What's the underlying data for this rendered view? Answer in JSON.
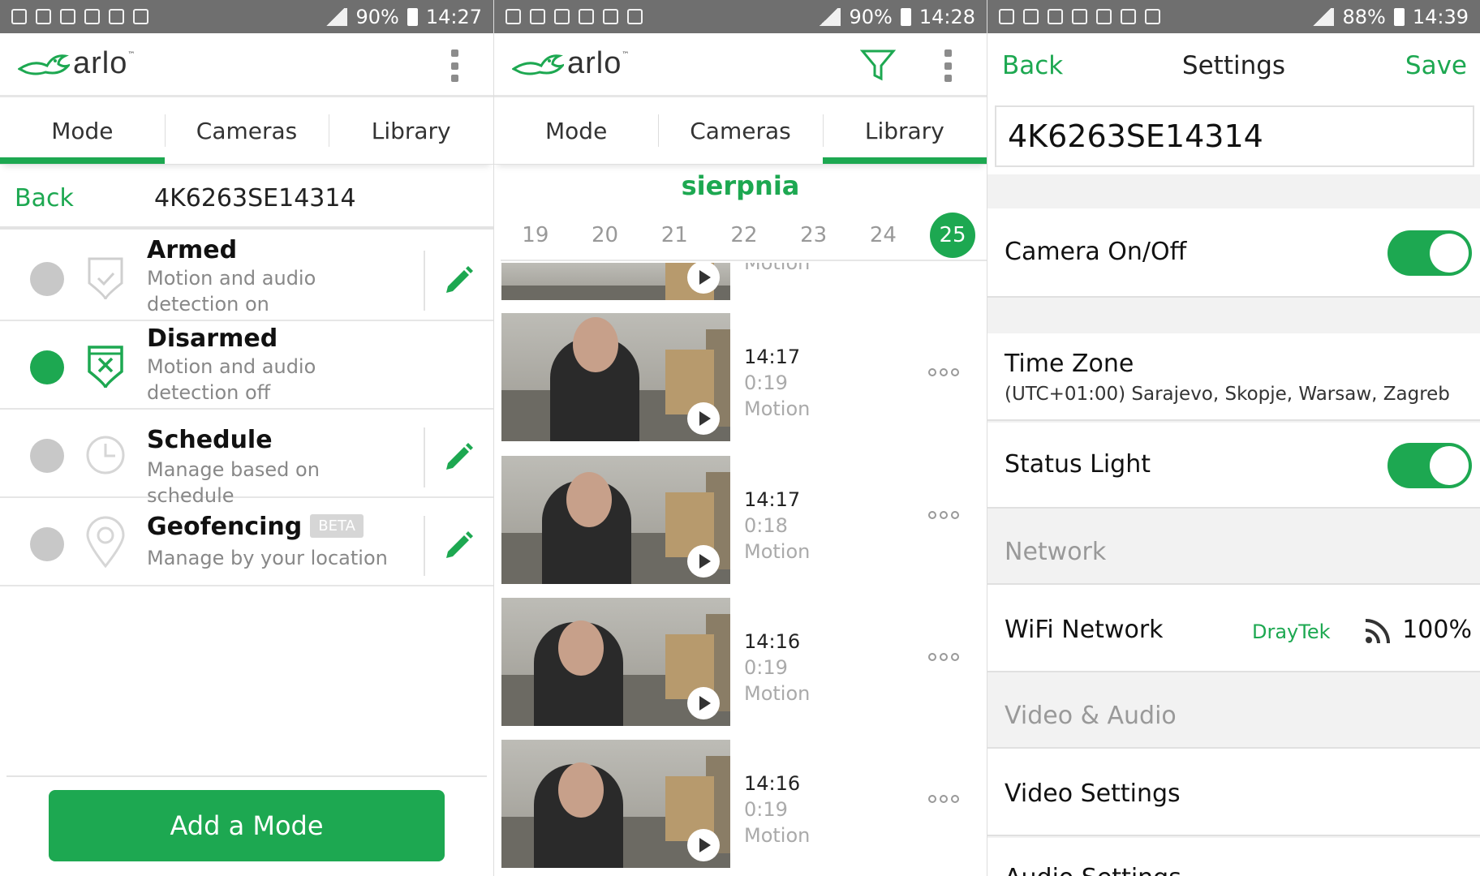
{
  "colors": {
    "accent": "#1da851",
    "status_bar": "#6f6f6f",
    "radio_off": "#c8c8c8"
  },
  "panel1": {
    "status": {
      "battery": "90%",
      "time": "14:27"
    },
    "logo": "arlo",
    "tabs": [
      {
        "label": "Mode",
        "active": true
      },
      {
        "label": "Cameras",
        "active": false
      },
      {
        "label": "Library",
        "active": false
      }
    ],
    "back_label": "Back",
    "device_name": "4K6263SE14314",
    "modes": [
      {
        "title": "Armed",
        "desc": "Motion and audio detection on",
        "selected": false,
        "icon": "shield-check-icon",
        "editable": true
      },
      {
        "title": "Disarmed",
        "desc": "Motion and audio detection off",
        "selected": true,
        "icon": "shield-x-icon",
        "editable": false
      },
      {
        "title": "Schedule",
        "desc": "Manage based on schedule",
        "selected": false,
        "icon": "clock-icon",
        "editable": true
      },
      {
        "title": "Geofencing",
        "badge": "BETA",
        "desc": "Manage by your location",
        "selected": false,
        "icon": "location-pin-icon",
        "editable": true
      }
    ],
    "add_mode_label": "Add a Mode"
  },
  "panel2": {
    "status": {
      "battery": "90%",
      "time": "14:28"
    },
    "logo": "arlo",
    "tabs": [
      {
        "label": "Mode",
        "active": false
      },
      {
        "label": "Cameras",
        "active": false
      },
      {
        "label": "Library",
        "active": true
      }
    ],
    "month": "sierpnia",
    "days": [
      "19",
      "20",
      "21",
      "22",
      "23",
      "24",
      "25"
    ],
    "selected_day": "25",
    "partial_clip_label": "Motion",
    "clips": [
      {
        "time": "14:17",
        "duration": "0:19",
        "type": "Motion"
      },
      {
        "time": "14:17",
        "duration": "0:18",
        "type": "Motion"
      },
      {
        "time": "14:16",
        "duration": "0:19",
        "type": "Motion"
      },
      {
        "time": "14:16",
        "duration": "0:19",
        "type": "Motion"
      }
    ]
  },
  "panel3": {
    "status": {
      "battery": "88%",
      "time": "14:39"
    },
    "back_label": "Back",
    "title": "Settings",
    "save_label": "Save",
    "camera_name": "4K6263SE14314",
    "camera_onoff": {
      "label": "Camera On/Off",
      "on": true
    },
    "timezone": {
      "label": "Time Zone",
      "value": "(UTC+01:00) Sarajevo, Skopje, Warsaw, Zagreb"
    },
    "status_light": {
      "label": "Status Light",
      "on": true
    },
    "network_header": "Network",
    "wifi": {
      "label": "WiFi Network",
      "ssid": "DrayTek",
      "signal": "100%"
    },
    "video_audio_header": "Video & Audio",
    "video_settings_label": "Video Settings",
    "audio_settings_label": "Audio Settings"
  }
}
